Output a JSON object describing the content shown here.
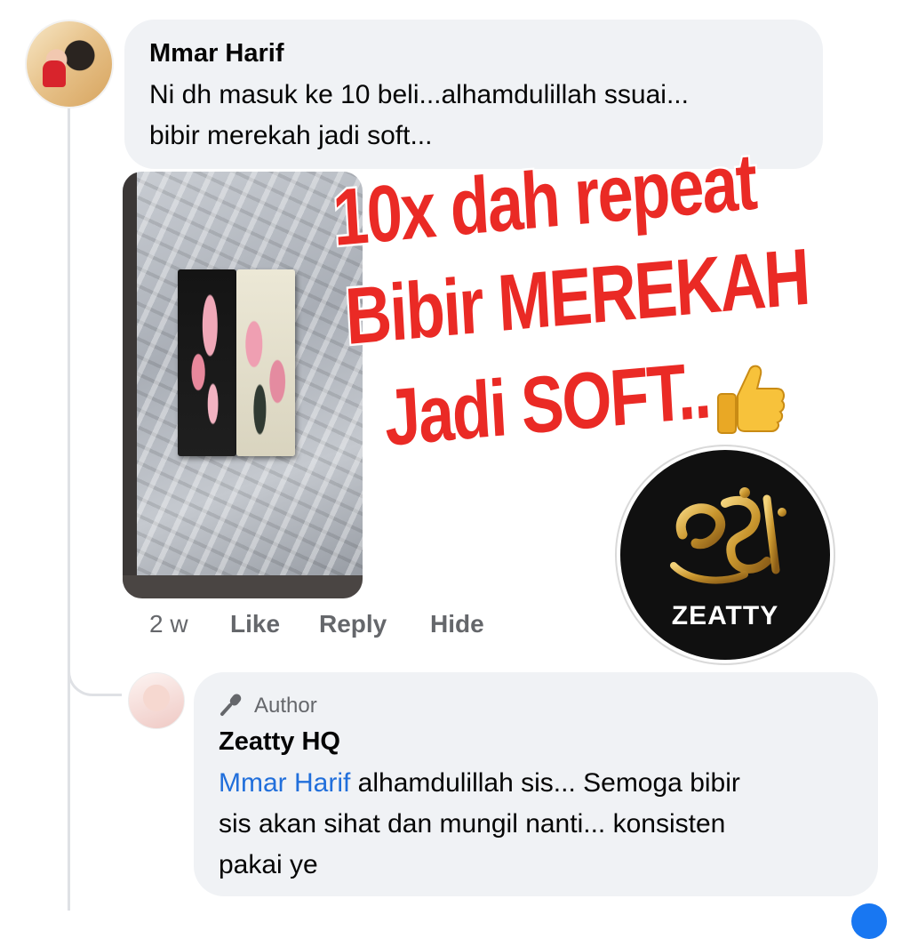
{
  "comment": {
    "author": "Mmar Harif",
    "text_line1": "Ni dh masuk ke 10 beli...alhamdulillah ssuai...",
    "text_line2": "bibir merekah jadi soft...",
    "actions": {
      "time": "2 w",
      "like": "Like",
      "reply": "Reply",
      "hide": "Hide"
    }
  },
  "photo_overlay": {
    "line1": "10x dah repeat",
    "line2": "Bibir MEREKAH",
    "line3": "Jadi SOFT..",
    "emoji": "thumbs-up-icon"
  },
  "brand_logo": {
    "wordmark": "ZEATTY",
    "colors": {
      "background": "#101010",
      "gold": "#c9962e"
    }
  },
  "reply": {
    "badge": "Author",
    "badge_icon": "microphone-icon",
    "author": "Zeatty HQ",
    "mention": "Mmar Harif",
    "text_part1": " alhamdulillah sis... Semoga bibir",
    "text_line2": "sis akan sihat dan mungil nanti... konsisten",
    "text_line3": "pakai ye"
  },
  "colors": {
    "bubble": "#f0f2f5",
    "meta_text": "#65676b",
    "mention": "#216fdb",
    "overlay_red": "#ea2a25"
  }
}
